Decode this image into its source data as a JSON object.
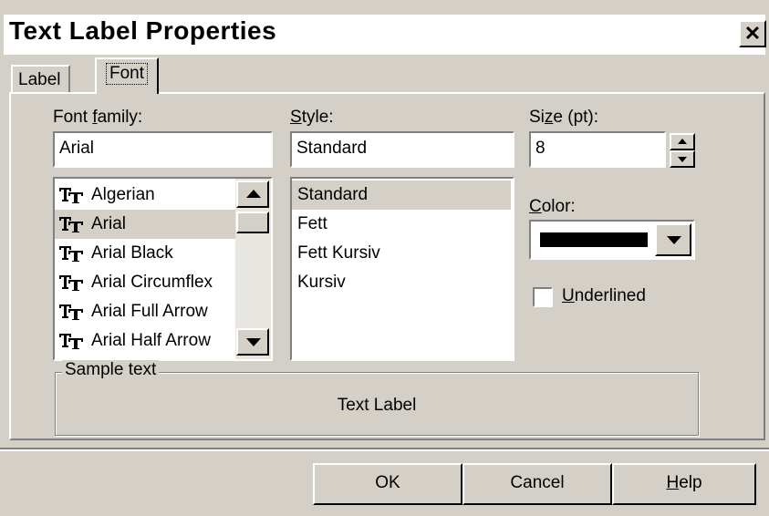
{
  "window": {
    "title": "Text Label Properties",
    "close_glyph": "✕"
  },
  "tabs": [
    {
      "label": "Label",
      "active": false
    },
    {
      "label": "Font",
      "active": true
    }
  ],
  "font_family": {
    "label_pre": "Font ",
    "label_mnemonic": "f",
    "label_post": "amily:",
    "value": "Arial",
    "options": [
      "Algerian",
      "Arial",
      "Arial Black",
      "Arial Circumflex",
      "Arial Full Arrow",
      "Arial Half Arrow"
    ],
    "selected": "Arial",
    "icon": "truetype-font-icon"
  },
  "style": {
    "label_mnemonic": "S",
    "label_post": "tyle:",
    "value": "Standard",
    "options": [
      "Standard",
      "Fett",
      "Fett Kursiv",
      "Kursiv"
    ],
    "selected": "Standard"
  },
  "size": {
    "label_pre": "Si",
    "label_mnemonic": "z",
    "label_post": "e (pt):",
    "value": "8"
  },
  "color": {
    "label_mnemonic": "C",
    "label_post": "olor:",
    "value": "#000000"
  },
  "underlined": {
    "label_mnemonic": "U",
    "label_post": "nderlined",
    "checked": false
  },
  "sample": {
    "label": "Sample text",
    "text": "Text Label"
  },
  "buttons": {
    "ok": "OK",
    "cancel": "Cancel",
    "help_mnemonic": "H",
    "help_post": "elp"
  },
  "colors": {
    "face": "#d4d0c8",
    "shadow": "#808080",
    "highlight": "#ffffff"
  }
}
